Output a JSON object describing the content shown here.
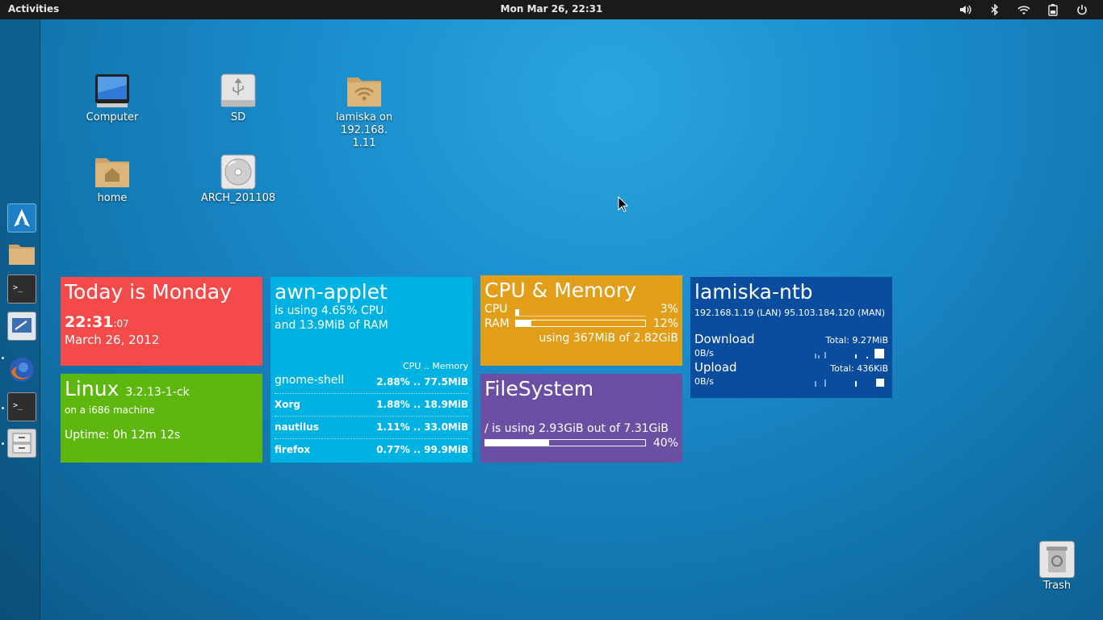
{
  "top_panel": {
    "activities": "Activities",
    "clock": "Mon Mar 26, 22:31"
  },
  "desktop_icons": {
    "computer": "Computer",
    "sd": "SD",
    "network_share": "lamiska on 192.168.",
    "network_share_2": "1.11",
    "home": "home",
    "dvd": "ARCH_201108",
    "trash": "Trash"
  },
  "date_tile": {
    "title": "Today is Monday",
    "time": "22:31",
    "seconds": ":07",
    "date": "March 26, 2012",
    "color": "#f44a4a"
  },
  "linux_tile": {
    "os": "Linux",
    "kernel": "3.2.13-1-ck",
    "machine": "on a i686 machine",
    "uptime": "Uptime: 0h 12m 12s",
    "color": "#5eb70f"
  },
  "awn_tile": {
    "title": "awn-applet",
    "cpu_line": "is using  4.65% CPU",
    "ram_line": "and 13.9MiB of RAM",
    "header": "CPU  ..  Memory",
    "processes": [
      {
        "name": "gnome-shell",
        "value": "2.88% .. 77.5MiB"
      },
      {
        "name": "Xorg",
        "value": "1.88% .. 18.9MiB"
      },
      {
        "name": "nautilus",
        "value": "1.11% .. 33.0MiB"
      },
      {
        "name": "firefox",
        "value": "0.77% .. 99.9MiB"
      }
    ],
    "color": "#00b2e2"
  },
  "cpu_tile": {
    "title": "CPU & Memory",
    "cpu_label": "CPU",
    "cpu_value": "3%",
    "cpu_fraction": 0.03,
    "ram_label": "RAM",
    "ram_value": "12%",
    "ram_fraction": 0.12,
    "usage": "using 367MiB of 2.82GiB",
    "color": "#e39e19"
  },
  "fs_tile": {
    "title": "FileSystem",
    "usage": "/ is using 2.93GiB out of 7.31GiB",
    "percent": "40%",
    "fraction": 0.4,
    "color": "#6b4fa3"
  },
  "net_tile": {
    "host": "lamiska-ntb",
    "ips": "192.168.1.19 (LAN) 95.103.184.120 (MAN)",
    "download_label": "Download",
    "download_rate": "0B/s",
    "download_total": "Total: 9.27MiB",
    "upload_label": "Upload",
    "upload_rate": "0B/s",
    "upload_total": "Total: 436KiB",
    "color": "#0a4d9e"
  }
}
